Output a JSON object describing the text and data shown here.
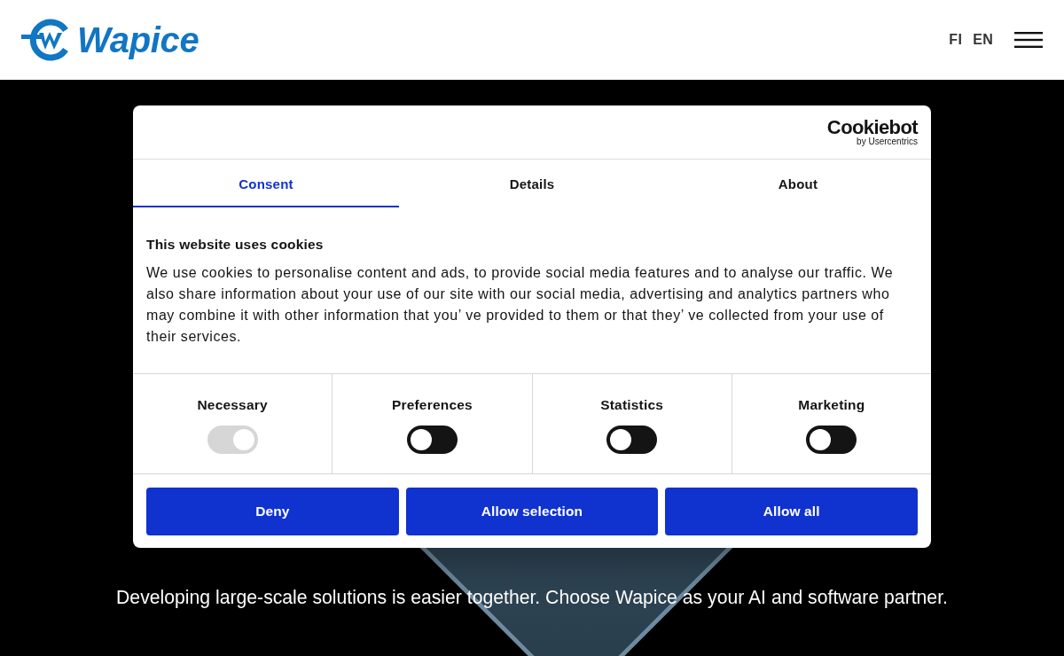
{
  "header": {
    "logo": "Wapice",
    "languages": [
      "FI",
      "EN"
    ]
  },
  "dialog": {
    "brand": {
      "name": "Cookiebot",
      "tagline": "by Usercentrics"
    },
    "tabs": [
      {
        "label": "Consent",
        "selected": true
      },
      {
        "label": "Details",
        "selected": false
      },
      {
        "label": "About",
        "selected": false
      }
    ],
    "title": "This website uses cookies",
    "body": "We use cookies to personalise content and ads, to provide social media features and to analyse our traffic. We also share information about your use of our site with our social media, advertising and analytics partners who may combine it with other information that you’ ve provided to them or that they’ ve collected from your use of their services.",
    "categories": [
      {
        "label": "Necessary",
        "checked": true,
        "disabled": true
      },
      {
        "label": "Preferences",
        "checked": false,
        "disabled": false
      },
      {
        "label": "Statistics",
        "checked": false,
        "disabled": false
      },
      {
        "label": "Marketing",
        "checked": false,
        "disabled": false
      }
    ],
    "buttons": [
      "Deny",
      "Allow selection",
      "Allow all"
    ]
  },
  "hero": {
    "subtitle": "Developing large-scale solutions is easier together. Choose Wapice as your AI and software partner."
  }
}
